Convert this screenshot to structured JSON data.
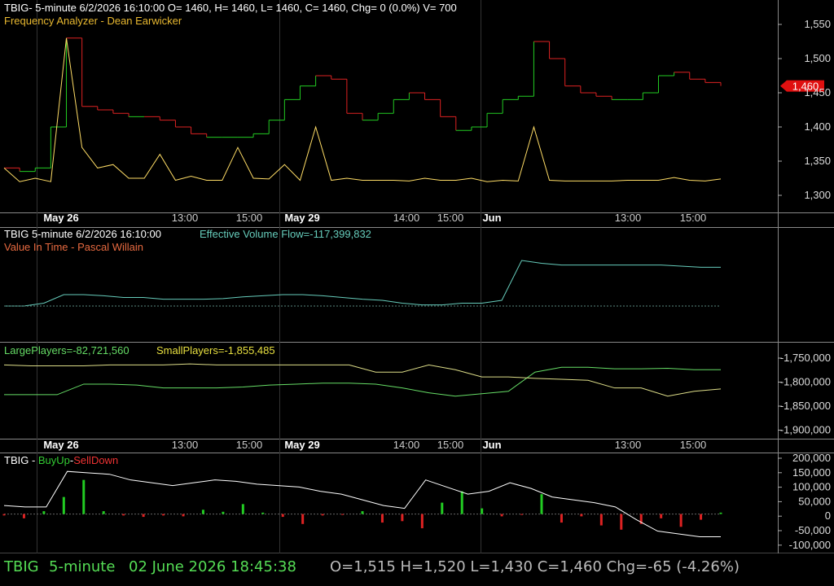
{
  "colors": {
    "background": "#000000",
    "up": "#22cc22",
    "down": "#dd2222",
    "price_line": "#ffdd66",
    "evf": "#66ccbb",
    "large": "#66dd66",
    "small": "#dddd88",
    "buy_sell_line": "#ffffff",
    "green_text": "#55dd55",
    "grey_text": "#bbbbbb"
  },
  "panel1": {
    "header": "TBIG- 5-minute 6/2/2026 16:10:00 O= 1460, H= 1460, L= 1460, C= 1460, Chg= 0 (0.0%) V= 700",
    "indicator": "Frequency Analyzer - Dean Earwicker",
    "current_price_tag": "1,460",
    "y_ticks": [
      "1,550",
      "1,500",
      "1,450",
      "1,400",
      "1,350",
      "1,300"
    ]
  },
  "panel2": {
    "header_symbol": "TBIG 5-minute  6/2/2026 16:10:00",
    "header_indicator": "Effective Volume Flow=-117,399,832",
    "indicator2": "Value In Time - Pascal Willain"
  },
  "panel3": {
    "large_label": "LargePlayers=-82,721,560",
    "small_label": "SmallPlayers=-1,855,485",
    "y_ticks": [
      "-1,750,000",
      "-1,800,000",
      "-1,850,000",
      "-1,900,000"
    ]
  },
  "panel4": {
    "title_symbol": "TBIG - ",
    "title_buyup": "BuyUp",
    "title_dash": "-",
    "title_selldown": "SellDown",
    "y_ticks": [
      "200,000",
      "150,000",
      "100,000",
      "50,000",
      "0",
      "-50,000",
      "-100,000"
    ]
  },
  "time_axis": [
    "May 26",
    "13:00",
    "15:00",
    "May 29",
    "14:00",
    "15:00",
    "Jun",
    "13:00",
    "15:00"
  ],
  "status_bar": {
    "symbol": "TBIG",
    "interval": "5-minute",
    "datetime": "02 June 2026 18:45:38",
    "ohlc": "O=1,515  H=1,520  L=1,430  C=1,460  Chg=-65 (-4.26%)"
  },
  "chart_data": [
    {
      "type": "line",
      "title": "TBIG 5-minute price",
      "y_scale": [
        1300,
        1550
      ],
      "x_count": 37,
      "x_labels": [
        "May 26",
        "13:00",
        "15:00",
        "May 29",
        "14:00",
        "15:00",
        "Jun",
        "13:00",
        "15:00"
      ],
      "series": [
        {
          "name": "price",
          "values": [
            1340,
            1335,
            1340,
            1400,
            1530,
            1430,
            1425,
            1420,
            1415,
            1415,
            1410,
            1400,
            1390,
            1385,
            1385,
            1385,
            1390,
            1410,
            1440,
            1460,
            1475,
            1470,
            1420,
            1410,
            1420,
            1440,
            1450,
            1440,
            1415,
            1395,
            1400,
            1420,
            1440,
            1445,
            1525,
            1500,
            1460,
            1450,
            1445,
            1440,
            1440,
            1450,
            1475,
            1480,
            1470,
            1465,
            1460
          ]
        },
        {
          "name": "Frequency Analyzer",
          "values": [
            1340,
            1320,
            1325,
            1320,
            1530,
            1370,
            1340,
            1345,
            1325,
            1325,
            1360,
            1322,
            1328,
            1322,
            1322,
            1370,
            1325,
            1324,
            1345,
            1322,
            1400,
            1322,
            1325,
            1322,
            1322,
            1322,
            1321,
            1325,
            1322,
            1322,
            1325,
            1320,
            1322,
            1321,
            1400,
            1322,
            1321,
            1321,
            1321,
            1321,
            1322,
            1322,
            1322,
            1326,
            1322,
            1321,
            1324
          ]
        }
      ]
    },
    {
      "type": "line",
      "series": [
        {
          "name": "Effective Volume Flow",
          "values": [
            0,
            0,
            0.05,
            0.2,
            0.2,
            0.18,
            0.15,
            0.15,
            0.12,
            0.12,
            0.12,
            0.13,
            0.16,
            0.18,
            0.2,
            0.2,
            0.18,
            0.15,
            0.12,
            0.1,
            0.05,
            0.02,
            0.02,
            0.05,
            0.05,
            0.1,
            0.8,
            0.75,
            0.72,
            0.72,
            0.72,
            0.72,
            0.72,
            0.72,
            0.7,
            0.68,
            0.68
          ]
        }
      ]
    },
    {
      "type": "line",
      "y_scale": [
        -1925000,
        -1725000
      ],
      "series": [
        {
          "name": "LargePlayers",
          "values": [
            -1852000,
            -1852000,
            -1852000,
            -1830000,
            -1830000,
            -1832000,
            -1838000,
            -1838000,
            -1838000,
            -1836000,
            -1832000,
            -1830000,
            -1828000,
            -1828000,
            -1830000,
            -1838000,
            -1848000,
            -1855000,
            -1850000,
            -1845000,
            -1805000,
            -1795000,
            -1795000,
            -1798000,
            -1798000,
            -1797000,
            -1800000,
            -1800000
          ]
        },
        {
          "name": "SmallPlayers",
          "values": [
            -1790000,
            -1792000,
            -1792000,
            -1792000,
            -1790000,
            -1790000,
            -1790000,
            -1788000,
            -1790000,
            -1790000,
            -1790000,
            -1790000,
            -1790000,
            -1790000,
            -1805000,
            -1805000,
            -1790000,
            -1800000,
            -1815000,
            -1815000,
            -1818000,
            -1820000,
            -1822000,
            -1838000,
            -1838000,
            -1855000,
            -1845000,
            -1840000
          ]
        }
      ]
    },
    {
      "type": "bar",
      "y_scale": [
        -110000,
        205000
      ],
      "series": [
        {
          "name": "BuyUp-SellDown line",
          "values": [
            30000,
            25000,
            25000,
            150000,
            145000,
            140000,
            120000,
            110000,
            100000,
            110000,
            120000,
            115000,
            105000,
            100000,
            95000,
            80000,
            70000,
            50000,
            30000,
            20000,
            120000,
            95000,
            70000,
            80000,
            110000,
            90000,
            60000,
            50000,
            40000,
            25000,
            -20000,
            -60000,
            -70000,
            -80000,
            -80000
          ]
        },
        {
          "name": "bars",
          "values": [
            -5000,
            -15000,
            10000,
            60000,
            120000,
            10000,
            -5000,
            -10000,
            -5000,
            -8000,
            15000,
            8000,
            35000,
            5000,
            -10000,
            -35000,
            -5000,
            -3000,
            10000,
            -30000,
            -25000,
            -50000,
            40000,
            80000,
            20000,
            -8000,
            -3000,
            70000,
            -30000,
            -8000,
            -40000,
            -55000,
            -35000,
            -15000,
            -45000,
            -20000,
            5000
          ]
        }
      ]
    }
  ]
}
